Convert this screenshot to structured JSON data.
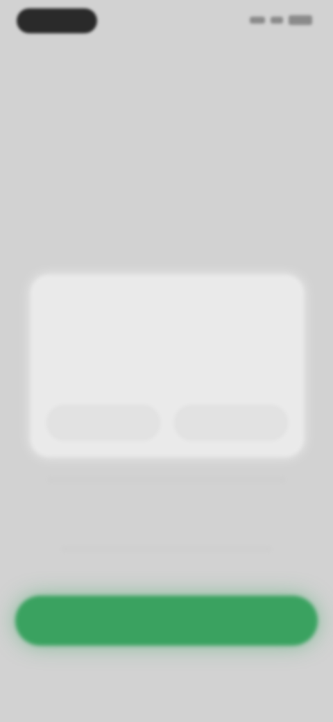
{
  "status_bar": {
    "time": "",
    "icons": [
      "signal-icon",
      "wifi-icon",
      "battery-icon"
    ]
  },
  "dialog": {
    "title": "",
    "body": "",
    "secondary_label": "",
    "primary_label": ""
  },
  "bottom_button": {
    "label": ""
  },
  "colors": {
    "background": "#d2d2d2",
    "dialog": "#eaeaea",
    "accent": "#3aa260"
  }
}
